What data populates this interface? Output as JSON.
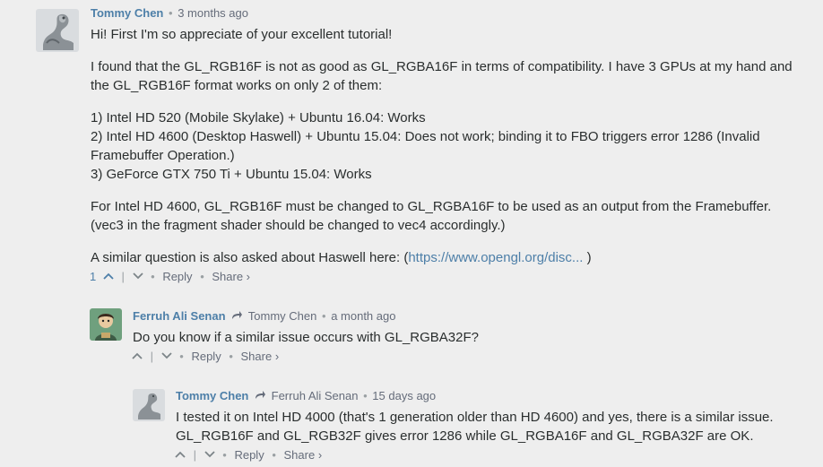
{
  "comments": [
    {
      "author": "Tommy Chen",
      "time": "3 months ago",
      "paragraphs": [
        "Hi! First I'm so appreciate of your excellent tutorial!",
        "I found that the GL_RGB16F is not as good as GL_RGBA16F in terms of compatibility. I have 3 GPUs at my hand and the GL_RGB16F format works on only 2 of them:",
        "1) Intel HD 520 (Mobile Skylake) + Ubuntu 16.04: Works",
        "2) Intel HD 4600 (Desktop Haswell) + Ubuntu 15.04: Does not work; binding it to FBO triggers error 1286 (Invalid Framebuffer Operation.)",
        "3) GeForce GTX 750 Ti + Ubuntu 15.04: Works",
        "For Intel HD 4600, GL_RGB16F must be changed to GL_RGBA16F to be used as an output from the Framebuffer. (vec3 in the fragment shader should be changed to vec4 accordingly.)"
      ],
      "last_prefix": "A similar question is also asked about Haswell here: (",
      "last_link": "https://www.opengl.org/disc...",
      "last_suffix": " )",
      "votes": "1",
      "up_icon": "chevron-up-icon",
      "down_icon": "chevron-down-icon",
      "reply_label": "Reply",
      "share_label": "Share ›"
    },
    {
      "author": "Ferruh Ali Senan",
      "reply_to": "Tommy Chen",
      "time": "a month ago",
      "text": "Do you know if a similar issue occurs with GL_RGBA32F?",
      "reply_label": "Reply",
      "share_label": "Share ›"
    },
    {
      "author": "Tommy Chen",
      "reply_to": "Ferruh Ali Senan",
      "time": "15 days ago",
      "text": "I tested it on Intel HD 4000 (that's 1 generation older than HD 4600) and yes, there is a similar issue. GL_RGB16F and GL_RGB32F gives error 1286 while GL_RGBA16F and GL_RGBA32F are OK.",
      "reply_label": "Reply",
      "share_label": "Share ›"
    }
  ],
  "colors": {
    "link": "#4d7fa8",
    "text": "#2a2e2e",
    "muted": "#656c7a",
    "background": "#eeeeee"
  }
}
